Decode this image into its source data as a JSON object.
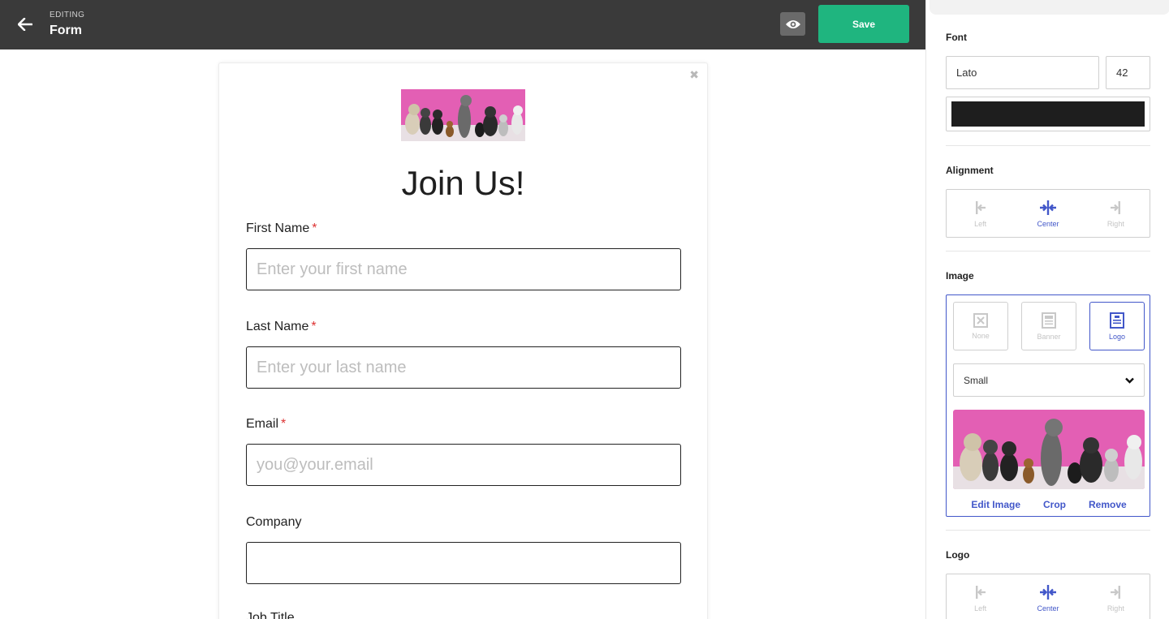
{
  "topbar": {
    "editing_label": "EDITING",
    "title": "Form",
    "save_label": "Save"
  },
  "form": {
    "heading": "Join Us!",
    "fields": [
      {
        "label": "First Name",
        "required": "*",
        "placeholder": "Enter your first name"
      },
      {
        "label": "Last Name",
        "required": "*",
        "placeholder": "Enter your last name"
      },
      {
        "label": "Email",
        "required": "*",
        "placeholder": "you@your.email"
      },
      {
        "label": "Company",
        "placeholder": ""
      },
      {
        "label": "Job Title"
      }
    ]
  },
  "panel": {
    "font": {
      "label": "Font",
      "family": "Lato",
      "size": "42",
      "color": "#1e1e1e"
    },
    "alignment": {
      "label": "Alignment",
      "options": [
        "Left",
        "Center",
        "Right"
      ],
      "selected": "Center"
    },
    "image": {
      "label": "Image",
      "options": [
        "None",
        "Banner",
        "Logo"
      ],
      "selected": "Logo",
      "size_value": "Small",
      "actions": [
        "Edit Image",
        "Crop",
        "Remove"
      ]
    },
    "logo": {
      "label": "Logo",
      "options": [
        "Left",
        "Center",
        "Right"
      ],
      "selected": "Center"
    }
  },
  "colors": {
    "topbar": "#3a3a3a",
    "save": "#1fb57f",
    "accent": "#4257c9",
    "required": "#dd3333",
    "photo_background": "#e35fb4"
  },
  "icons": [
    "back-arrow-icon",
    "eye-icon",
    "close-icon",
    "align-left-icon",
    "align-center-icon",
    "align-right-icon",
    "image-none-icon",
    "image-banner-icon",
    "image-logo-icon",
    "chevron-down-icon"
  ]
}
